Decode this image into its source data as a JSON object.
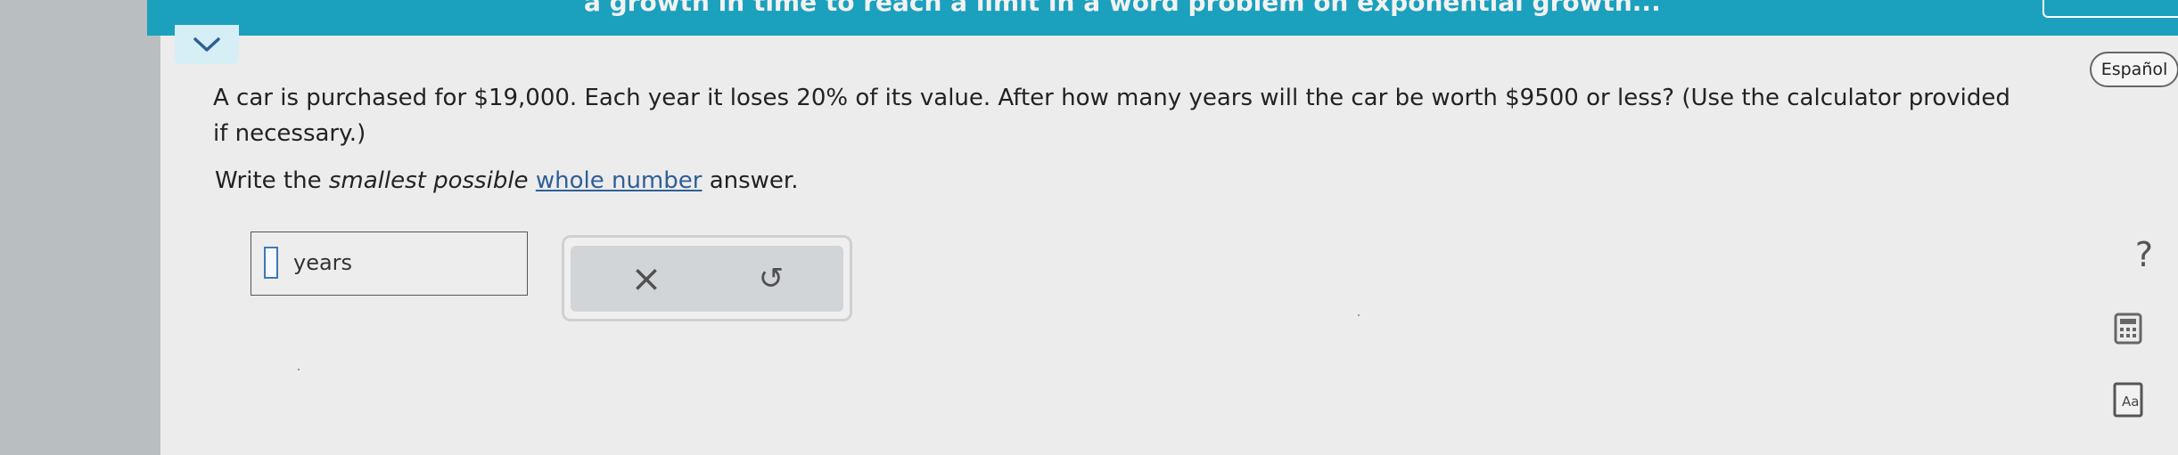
{
  "header": {
    "title": "a growth in time to reach a limit in a word problem on exponential growth..."
  },
  "question": {
    "text": "A car is purchased for $19,000. Each year it loses 20% of its value. After how many years will the car be worth $9500 or less? (Use the calculator provided if necessary.)",
    "instruction_prefix": "Write the ",
    "instruction_emphasis": "smallest possible",
    "instruction_link": "whole number",
    "instruction_suffix": " answer."
  },
  "answer": {
    "value": "",
    "unit": "years"
  },
  "toolbar": {
    "clear_label": "×",
    "undo_label": "↺"
  },
  "sidebar": {
    "language_label": "Español",
    "help_label": "?"
  },
  "colors": {
    "accent": "#1ba0bd",
    "panel": "#ececec",
    "link": "#2f5f96"
  }
}
